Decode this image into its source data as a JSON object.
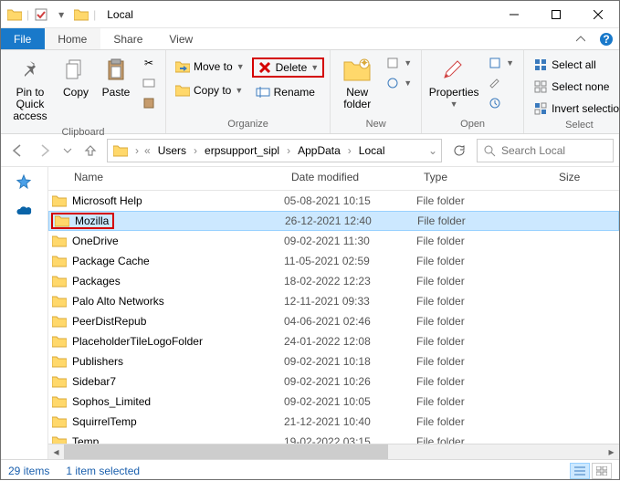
{
  "window": {
    "title": "Local"
  },
  "tabs": {
    "file": "File",
    "home": "Home",
    "share": "Share",
    "view": "View"
  },
  "ribbon": {
    "pin": "Pin to Quick access",
    "copy": "Copy",
    "paste": "Paste",
    "moveto": "Move to",
    "copyto": "Copy to",
    "delete": "Delete",
    "rename": "Rename",
    "newfolder": "New folder",
    "properties": "Properties",
    "selectall": "Select all",
    "selectnone": "Select none",
    "invert": "Invert selection",
    "group_clipboard": "Clipboard",
    "group_organize": "Organize",
    "group_new": "New",
    "group_open": "Open",
    "group_select": "Select"
  },
  "breadcrumbs": [
    "Users",
    "erpsupport_sipl",
    "AppData",
    "Local"
  ],
  "search": {
    "placeholder": "Search Local"
  },
  "columns": {
    "name": "Name",
    "date": "Date modified",
    "type": "Type",
    "size": "Size"
  },
  "rows": [
    {
      "name": "Microsoft Help",
      "date": "05-08-2021 10:15",
      "type": "File folder"
    },
    {
      "name": "Mozilla",
      "date": "26-12-2021 12:40",
      "type": "File folder",
      "selected": true,
      "highlighted": true
    },
    {
      "name": "OneDrive",
      "date": "09-02-2021 11:30",
      "type": "File folder"
    },
    {
      "name": "Package Cache",
      "date": "11-05-2021 02:59",
      "type": "File folder"
    },
    {
      "name": "Packages",
      "date": "18-02-2022 12:23",
      "type": "File folder"
    },
    {
      "name": "Palo Alto Networks",
      "date": "12-11-2021 09:33",
      "type": "File folder"
    },
    {
      "name": "PeerDistRepub",
      "date": "04-06-2021 02:46",
      "type": "File folder"
    },
    {
      "name": "PlaceholderTileLogoFolder",
      "date": "24-01-2022 12:08",
      "type": "File folder"
    },
    {
      "name": "Publishers",
      "date": "09-02-2021 10:18",
      "type": "File folder"
    },
    {
      "name": "Sidebar7",
      "date": "09-02-2021 10:26",
      "type": "File folder"
    },
    {
      "name": "Sophos_Limited",
      "date": "09-02-2021 10:05",
      "type": "File folder"
    },
    {
      "name": "SquirrelTemp",
      "date": "21-12-2021 10:40",
      "type": "File folder"
    },
    {
      "name": "Temp",
      "date": "19-02-2022 03:15",
      "type": "File folder"
    }
  ],
  "status": {
    "count": "29 items",
    "selection": "1 item selected"
  }
}
